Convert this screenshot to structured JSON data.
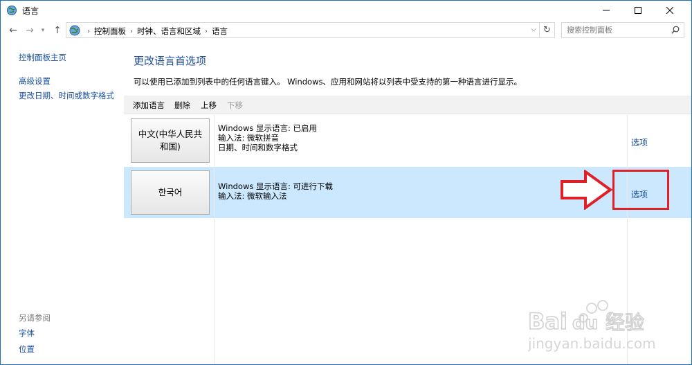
{
  "window": {
    "title": "语言"
  },
  "navbar": {
    "breadcrumbs": [
      "控制面板",
      "时钟、语言和区域",
      "语言"
    ],
    "search_placeholder": "搜索控制面板"
  },
  "leftpane": {
    "home": "控制面板主页",
    "advanced": "高级设置",
    "datetime": "更改日期、时间或数字格式",
    "see_also": "另请参阅",
    "fonts": "字体",
    "location": "位置"
  },
  "main": {
    "title": "更改语言首选项",
    "description": "可以使用已添加到列表中的任何语言键入。 Windows、应用和网站将以列表中受支持的第一种语言进行显示。",
    "toolbar": {
      "add": "添加语言",
      "remove": "删除",
      "move_up": "上移",
      "move_down": "下移"
    },
    "languages": [
      {
        "name": "中文(中华人民共和国)",
        "lines": [
          "Windows 显示语言: 已启用",
          "输入法: 微软拼音",
          "日期、时间和数字格式"
        ],
        "options": "选项",
        "selected": false
      },
      {
        "name": "한국어",
        "lines": [
          "Windows 显示语言: 可进行下载",
          "输入法: 微软输入法"
        ],
        "options": "选项",
        "selected": true
      }
    ]
  },
  "colors": {
    "accent": "#1a4fa0",
    "selection": "#cce8ff",
    "annotation": "#e01f26"
  },
  "watermark": {
    "brand": "Bai du 经验",
    "url": "jingyan.baidu.com"
  }
}
